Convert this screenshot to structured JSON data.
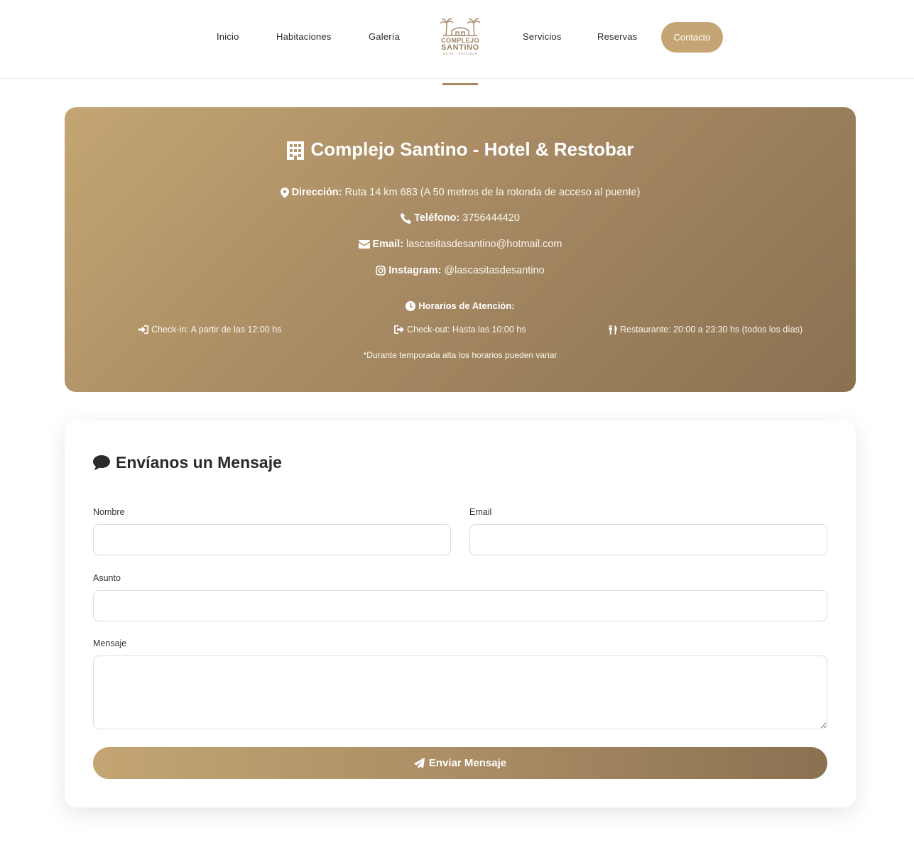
{
  "nav": {
    "items": [
      "Inicio",
      "Habitaciones",
      "Galería",
      "Servicios",
      "Reservas"
    ],
    "cta": "Contacto",
    "logo": {
      "line1": "COMPLEJO",
      "line2": "SANTINO",
      "line3": "HOTEL · RESTOBAR"
    }
  },
  "info": {
    "title": "Complejo Santino - Hotel & Restobar",
    "address_label": "Dirección:",
    "address_value": "Ruta 14 km 683 (A 50 metros de la rotonda de acceso al puente)",
    "phone_label": "Teléfono:",
    "phone_value": "3756444420",
    "email_label": "Email:",
    "email_value": "lascasitasdesantino@hotmail.com",
    "instagram_label": "Instagram:",
    "instagram_value": "@lascasitasdesantino",
    "hours_title": "Horarios de Atención:",
    "checkin": "Check-in: A partir de las 12:00 hs",
    "checkout": "Check-out: Hasta las 10:00 hs",
    "restaurant": "Restaurante: 20:00 a 23:30 hs (todos los días)",
    "note": "*Durante temporada alta los horarios pueden variar",
    "icons": [
      "building-icon",
      "map-pin-icon",
      "phone-icon",
      "envelope-icon",
      "instagram-icon",
      "clock-icon",
      "sign-in-icon",
      "sign-out-icon",
      "utensils-icon"
    ]
  },
  "form": {
    "title": "Envíanos un Mensaje",
    "name_label": "Nombre",
    "email_label": "Email",
    "subject_label": "Asunto",
    "message_label": "Mensaje",
    "submit_label": "Enviar Mensaje",
    "icons": [
      "comment-icon",
      "paper-plane-icon"
    ]
  },
  "colors": {
    "accent": "#c6a574",
    "gradient_start": "#c4a572",
    "gradient_end": "#8a7150"
  }
}
